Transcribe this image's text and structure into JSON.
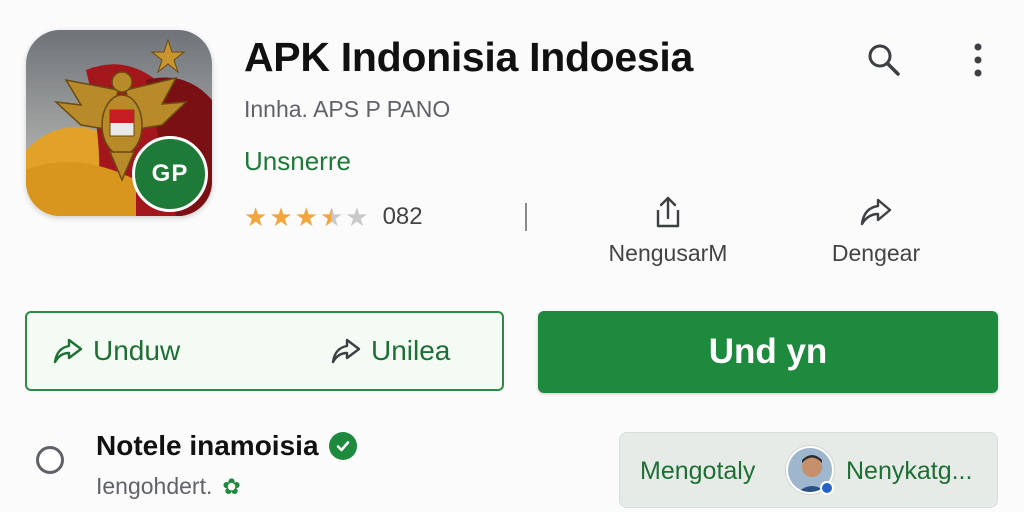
{
  "app": {
    "title": "APK Indonisia Indoesia",
    "developer": "Innha. APS P PANO",
    "category": "Unsnerre",
    "icon_badge": "GP",
    "rating_stars": 3.5,
    "rating_count": "082"
  },
  "actions": {
    "share_label": "NengusarM",
    "other_label": "Dengear"
  },
  "buttons": {
    "download_label": "Unduw",
    "update_label": "Unilea",
    "install_label": "Und yn"
  },
  "bottom": {
    "title": "Notele inamoisia",
    "subtitle": "Iengohdert."
  },
  "chip": {
    "left_label": "Mengotaly",
    "right_label": "Nenykatg..."
  },
  "icons": {
    "search": "search-icon",
    "more": "more-vert-icon",
    "share": "share-icon",
    "forward": "forward-icon",
    "verified": "verified-check-icon",
    "gear": "gear-icon"
  },
  "colors": {
    "primary_green": "#1e8a3e",
    "text_green": "#1e6f33",
    "star": "#f2a53c"
  }
}
